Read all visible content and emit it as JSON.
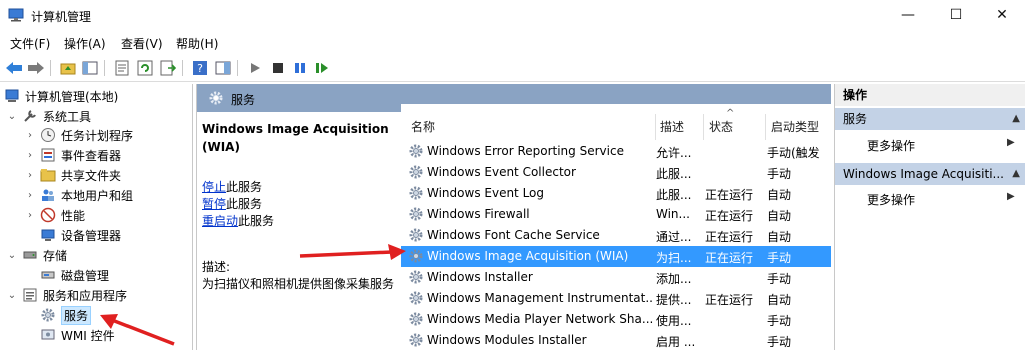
{
  "window": {
    "title": "计算机管理",
    "controls": {
      "minimize": "—",
      "maximize": "☐",
      "close": "✕"
    }
  },
  "menu": [
    "文件(F)",
    "操作(A)",
    "查看(V)",
    "帮助(H)"
  ],
  "tree": {
    "root": "计算机管理(本地)",
    "system_tools": "系统工具",
    "task_scheduler": "任务计划程序",
    "event_viewer": "事件查看器",
    "shared_folders": "共享文件夹",
    "local_users": "本地用户和组",
    "performance": "性能",
    "device_manager": "设备管理器",
    "storage": "存储",
    "disk_management": "磁盘管理",
    "services_apps": "服务和应用程序",
    "services": "服务",
    "wmi": "WMI 控件"
  },
  "middle": {
    "header": "服务",
    "detail_title": "Windows Image Acquisition (WIA)",
    "link_stop": "停止",
    "link_stop_suffix": "此服务",
    "link_pause": "暂停",
    "link_pause_suffix": "此服务",
    "link_restart": "重启动",
    "link_restart_suffix": "此服务",
    "desc_label": "描述:",
    "desc_text": "为扫描仪和照相机提供图像采集服务"
  },
  "list": {
    "columns": [
      "名称",
      "描述",
      "状态",
      "启动类型"
    ],
    "rows": [
      {
        "name": "Windows Error Reporting Service",
        "desc": "允许...",
        "status": "",
        "startup": "手动(触发"
      },
      {
        "name": "Windows Event Collector",
        "desc": "此服...",
        "status": "",
        "startup": "手动"
      },
      {
        "name": "Windows Event Log",
        "desc": "此服...",
        "status": "正在运行",
        "startup": "自动"
      },
      {
        "name": "Windows Firewall",
        "desc": "Win...",
        "status": "正在运行",
        "startup": "自动"
      },
      {
        "name": "Windows Font Cache Service",
        "desc": "通过...",
        "status": "正在运行",
        "startup": "自动"
      },
      {
        "name": "Windows Image Acquisition (WIA)",
        "desc": "为扫...",
        "status": "正在运行",
        "startup": "手动"
      },
      {
        "name": "Windows Installer",
        "desc": "添加...",
        "status": "",
        "startup": "手动"
      },
      {
        "name": "Windows Management Instrumentat...",
        "desc": "提供...",
        "status": "正在运行",
        "startup": "自动"
      },
      {
        "name": "Windows Media Player Network Sha...",
        "desc": "使用...",
        "status": "",
        "startup": "手动"
      },
      {
        "name": "Windows Modules Installer",
        "desc": "启用 ...",
        "status": "",
        "startup": "手动"
      }
    ],
    "selected_index": 5
  },
  "actions": {
    "title": "操作",
    "group1": "服务",
    "group1_more": "更多操作",
    "group2": "Windows Image Acquisiti...",
    "group2_more": "更多操作"
  },
  "colors": {
    "selection": "#3399ff",
    "header_band": "#8aa3c3",
    "annotation_arrow": "#e02020",
    "link": "#0033cc"
  }
}
